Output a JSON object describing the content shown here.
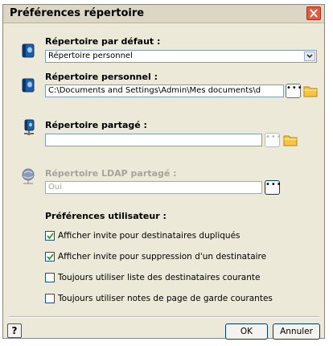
{
  "window": {
    "title": "Préférences répertoire"
  },
  "default_directory": {
    "label": "Répertoire par défaut :",
    "selected": "Répertoire personnel"
  },
  "personal_directory": {
    "label": "Répertoire personnel :",
    "value": "C:\\Documents and Settings\\Admin\\Mes documents\\d"
  },
  "shared_directory": {
    "label": "Répertoire partagé :",
    "value": ""
  },
  "ldap_directory": {
    "label": "Répertoire LDAP partagé :",
    "value": "Oui"
  },
  "user_prefs": {
    "heading": "Préférences utilisateur :",
    "options": [
      {
        "label": "Afficher invite pour destinataires dupliqués",
        "checked": true
      },
      {
        "label": "Afficher invite pour suppression d'un destinataire",
        "checked": true
      },
      {
        "label": "Toujours utiliser liste des destinataires courante",
        "checked": false
      },
      {
        "label": "Toujours utiliser notes de page de garde courantes",
        "checked": false
      }
    ]
  },
  "buttons": {
    "help": "?",
    "ok": "OK",
    "cancel": "Annuler",
    "browse": "•••"
  },
  "icons": {
    "default": "book-icon",
    "personal": "book-icon",
    "shared": "network-book-icon",
    "ldap": "network-globe-icon",
    "folder": "folder-icon",
    "close": "close-icon"
  }
}
